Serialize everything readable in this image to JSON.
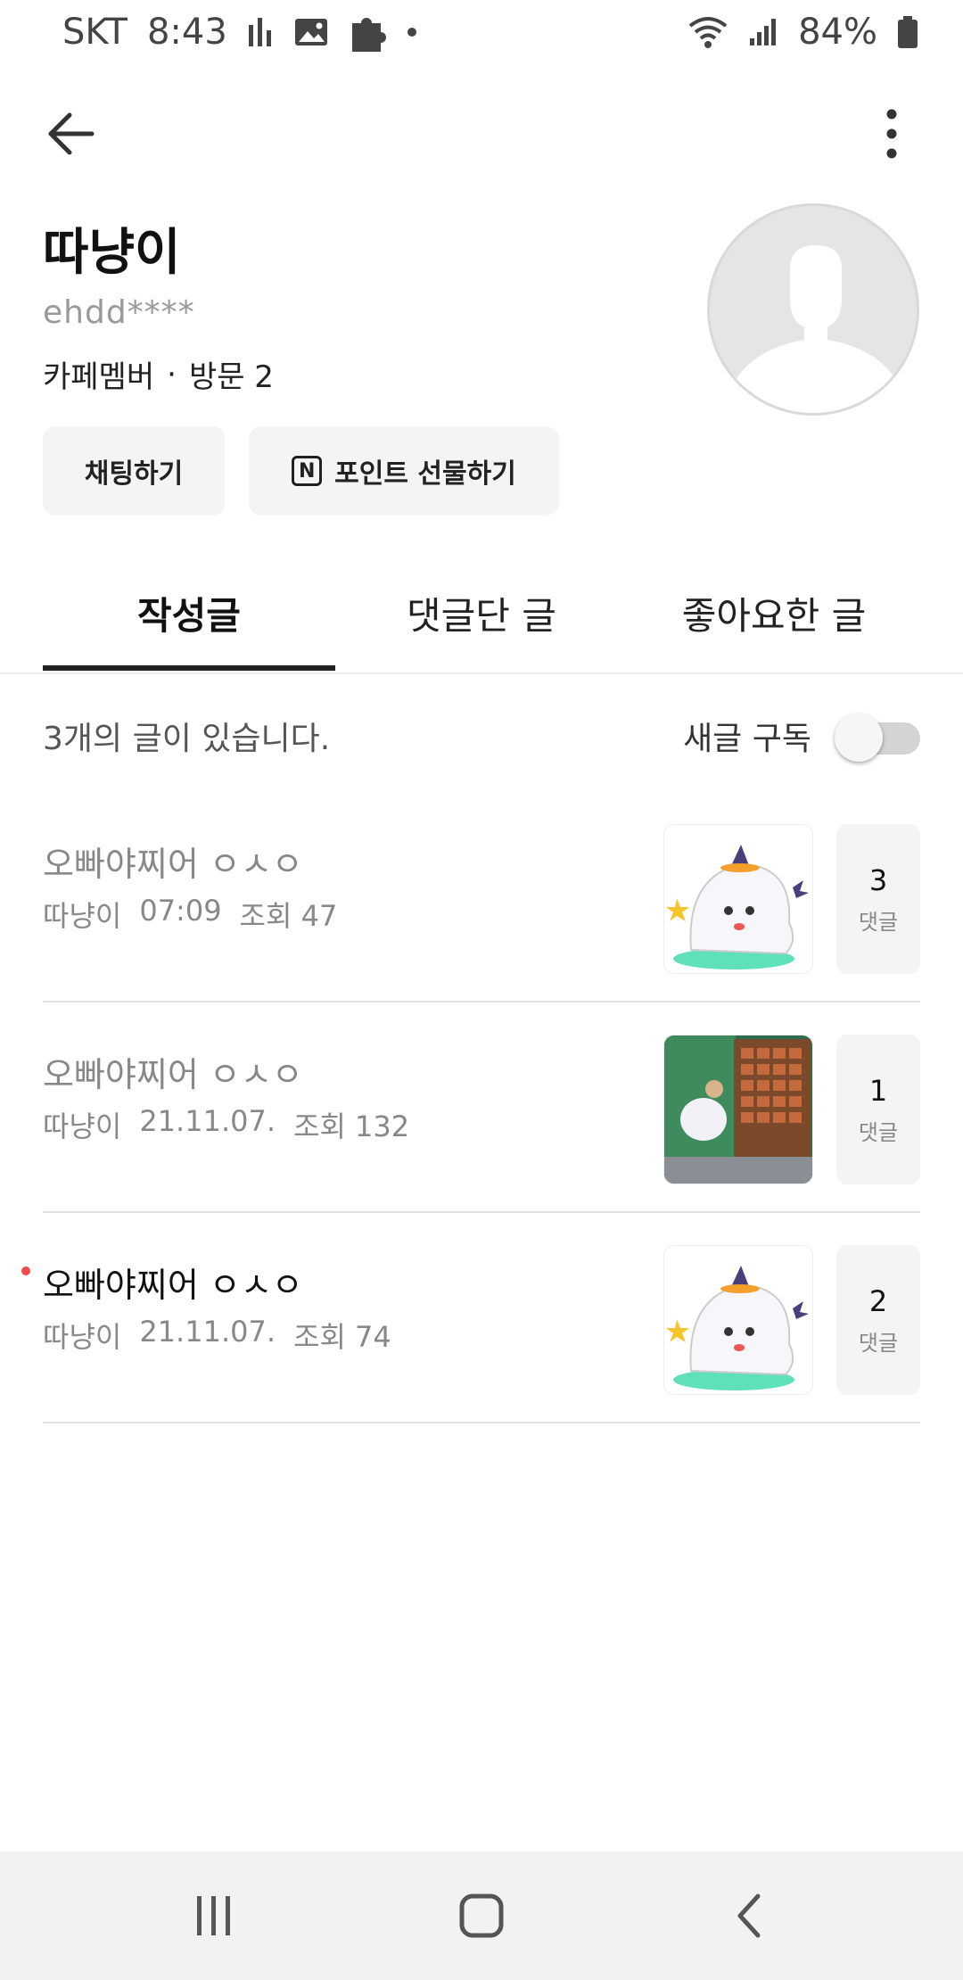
{
  "status_bar": {
    "carrier": "SKT",
    "time": "8:43",
    "battery": "84%"
  },
  "profile": {
    "name": "따냥이",
    "user_id": "ehdd****",
    "role": "카페멤버",
    "separator": "·",
    "visits": "방문 2"
  },
  "actions": {
    "chat_label": "채팅하기",
    "point_label": "포인트 선물하기",
    "point_icon_letter": "N"
  },
  "tabs": [
    {
      "label": "작성글",
      "active": true
    },
    {
      "label": "댓글단 글",
      "active": false
    },
    {
      "label": "좋아요한 글",
      "active": false
    }
  ],
  "list_header": {
    "count_text": "3개의 글이 있습니다.",
    "subscribe_label": "새글 구독",
    "subscribe_on": false
  },
  "posts": [
    {
      "title": "오빠야찌어 ㅇㅅㅇ",
      "author": "따냥이",
      "date": "07:09",
      "views": "조회 47",
      "comments": "3",
      "comment_label": "댓글",
      "unread": false
    },
    {
      "title": "오빠야찌어 ㅇㅅㅇ",
      "author": "따냥이",
      "date": "21.11.07.",
      "views": "조회 132",
      "comments": "1",
      "comment_label": "댓글",
      "unread": false
    },
    {
      "title": "오빠야찌어 ㅇㅅㅇ",
      "author": "따냥이",
      "date": "21.11.07.",
      "views": "조회 74",
      "comments": "2",
      "comment_label": "댓글",
      "unread": true
    }
  ],
  "colors": {
    "accent_dark": "#222222",
    "unread_dot": "#f04b4b",
    "button_bg": "#f3f4f6",
    "navbar_bg": "#f2f2f2"
  }
}
